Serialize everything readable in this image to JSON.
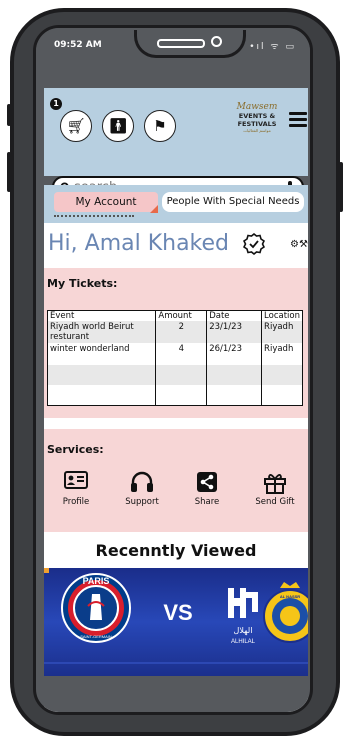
{
  "status_bar": {
    "time": "09:52 AM",
    "icons": "•ıl ᯤ ▭"
  },
  "header": {
    "cart_badge": "1",
    "cart_icon": "cart-icon",
    "accessibility_icon": "accessibility-icon",
    "flag_icon": "flag-icon",
    "logo": {
      "script": "Mawsem",
      "line1": "EVENTS &",
      "line2": "FESTIVALS",
      "tagline": "مواسم الفعاليات"
    },
    "search_placeholder": "search"
  },
  "tabs": {
    "my_account": "My Account",
    "special_needs": "People With Special Needs"
  },
  "greeting": "Hi, Amal Khaked",
  "tickets": {
    "title": "My Tickets:",
    "columns": [
      "Event",
      "Amount",
      "Date",
      "Location"
    ],
    "rows": [
      {
        "event": "Riyadh world Beirut resturant",
        "amount": "2",
        "date": "23/1/23",
        "location": "Riyadh"
      },
      {
        "event": "winter wonderland",
        "amount": "4",
        "date": "26/1/23",
        "location": "Riyadh"
      }
    ]
  },
  "services": {
    "title": "Services:",
    "items": [
      {
        "label": "Profile",
        "icon": "id-card-icon"
      },
      {
        "label": "Support",
        "icon": "headphones-icon"
      },
      {
        "label": "Share",
        "icon": "share-icon"
      },
      {
        "label": "Send Gift",
        "icon": "gift-icon"
      }
    ]
  },
  "recently_viewed": {
    "title": "Recenntly Viewed",
    "banner": {
      "team1": "PARIS",
      "team1_sub": "SAINT-GERMAIN",
      "vs": "VS",
      "team2": "الهلال",
      "team2_en": "ALHILAL",
      "team3": "AL NASSR"
    }
  },
  "colors": {
    "header_bg": "#b7cfe0",
    "pink_bg": "#f7d6d6",
    "greeting": "#6a86b3",
    "tab_active": "#f5c6c8",
    "banner": "#2848b8"
  }
}
